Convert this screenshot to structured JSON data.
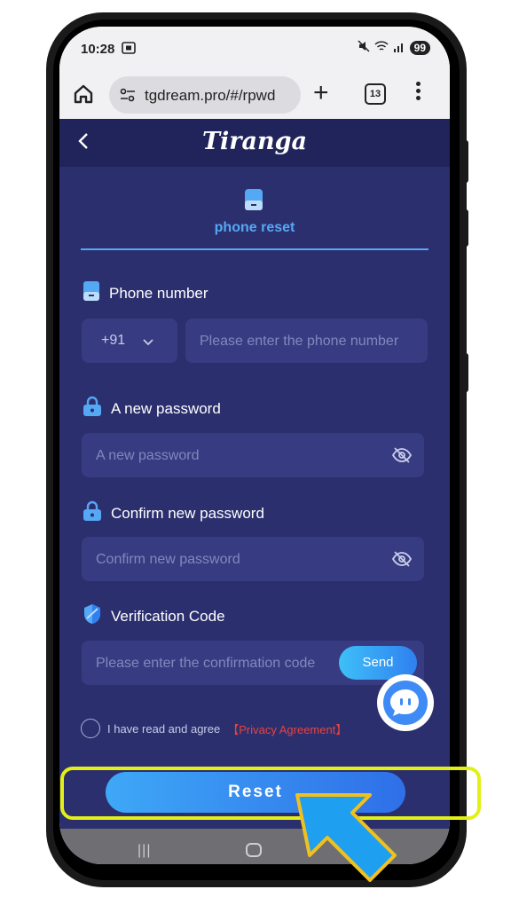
{
  "status_bar": {
    "time": "10:28",
    "battery": "99"
  },
  "browser": {
    "url": "tgdream.pro/#/rpwd",
    "tab_count": "13"
  },
  "app": {
    "logo": "Tiranga",
    "mode_label": "phone reset",
    "phone_label": "Phone number",
    "country_code": "+91",
    "phone_placeholder": "Please enter the phone number",
    "new_password_label": "A new password",
    "new_password_placeholder": "A new password",
    "confirm_password_label": "Confirm new password",
    "confirm_password_placeholder": "Confirm new password",
    "code_label": "Verification Code",
    "code_placeholder": "Please enter the confirmation code",
    "send_label": "Send",
    "agree_text": "I have read and agree",
    "privacy_link": "【Privacy Agreement】",
    "reset_label": "Reset"
  },
  "colors": {
    "app_bg": "#2b2f6e",
    "header_bg": "#20245a",
    "input_bg": "#373c82",
    "accent_blue": "#55a8f4",
    "privacy_red": "#e8433f",
    "highlight_yellow": "#e2f016",
    "arrow_blue": "#1f9ff0",
    "arrow_outline": "#f0c020"
  },
  "icons": [
    "home-icon",
    "tune-icon",
    "plus-icon",
    "tabs-icon",
    "more-vert-icon",
    "back-chevron-icon",
    "phone-icon",
    "lock-icon",
    "eye-off-icon",
    "shield-icon",
    "chevron-down-icon",
    "support-chat-icon",
    "arrow-pointer-icon"
  ]
}
